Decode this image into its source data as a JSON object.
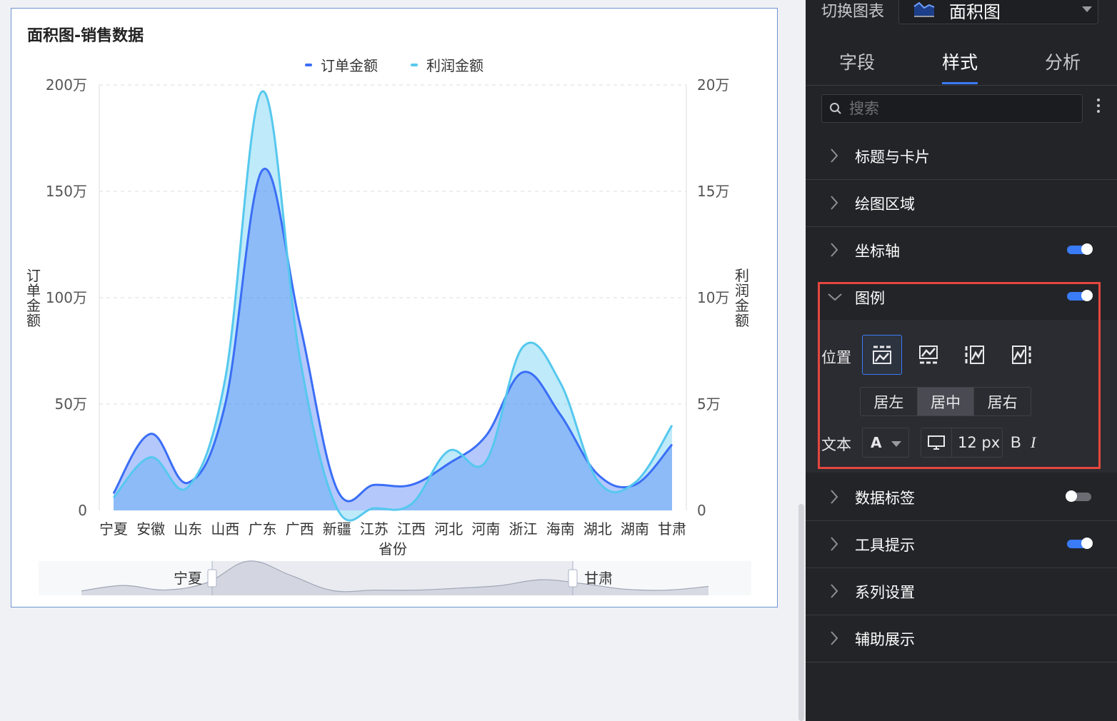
{
  "chart_card": {
    "title": "面积图-销售数据",
    "y_left_title": "订单金额",
    "y_right_title": "利润金额",
    "x_title": "省份",
    "slider": {
      "start_label": "宁夏",
      "end_label": "甘肃"
    }
  },
  "chart_data": {
    "type": "area",
    "title": "面积图-销售数据",
    "xlabel": "省份",
    "ylabel": "订单金额",
    "y2label": "利润金额",
    "categories": [
      "宁夏",
      "安徽",
      "山东",
      "山西",
      "广东",
      "广西",
      "新疆",
      "江苏",
      "江西",
      "河北",
      "河南",
      "浙江",
      "海南",
      "湖北",
      "湖南",
      "甘肃"
    ],
    "series": [
      {
        "name": "订单金额",
        "axis": "left",
        "color": "#3b6ef6",
        "values": [
          80000,
          360000,
          130000,
          500000,
          1600000,
          880000,
          100000,
          120000,
          120000,
          220000,
          350000,
          650000,
          450000,
          170000,
          120000,
          310000
        ]
      },
      {
        "name": "利润金额",
        "axis": "right",
        "color": "#56c8ee",
        "values": [
          6000,
          25000,
          11000,
          62000,
          197000,
          72000,
          1000,
          1000,
          3000,
          28000,
          23000,
          77000,
          60000,
          14000,
          13000,
          40000
        ]
      }
    ],
    "y_left_ticks": [
      "0",
      "50万",
      "100万",
      "150万",
      "200万"
    ],
    "y_right_ticks": [
      "0",
      "5万",
      "10万",
      "15万",
      "20万"
    ],
    "ylim_left": [
      0,
      2000000
    ],
    "ylim_right": [
      0,
      200000
    ],
    "legend_position": "top-center",
    "grid": true
  },
  "panel": {
    "switch_label": "切换图表",
    "chart_type": "面积图",
    "tabs": [
      {
        "label": "字段"
      },
      {
        "label": "样式"
      },
      {
        "label": "分析"
      }
    ],
    "search_placeholder": "搜索",
    "sections": {
      "title_card": "标题与卡片",
      "plot_area": "绘图区域",
      "axis": "坐标轴",
      "legend": "图例",
      "data_label": "数据标签",
      "tooltip": "工具提示",
      "series": "系列设置",
      "assist": "辅助展示"
    },
    "toggles": {
      "axis": true,
      "legend": true,
      "data_label": false,
      "tooltip": true
    },
    "legend_settings": {
      "position_label": "位置",
      "align_options": [
        "居左",
        "居中",
        "居右"
      ],
      "align_selected": "居中",
      "text_label": "文本",
      "font_color_letter": "A",
      "font_size": "12 px",
      "bold": "B",
      "italic": "I"
    }
  },
  "colors": {
    "accent": "#3a7bf6",
    "order_series": "#3b6ef6",
    "profit_series": "#56c8ee",
    "highlight": "#e5473e"
  }
}
